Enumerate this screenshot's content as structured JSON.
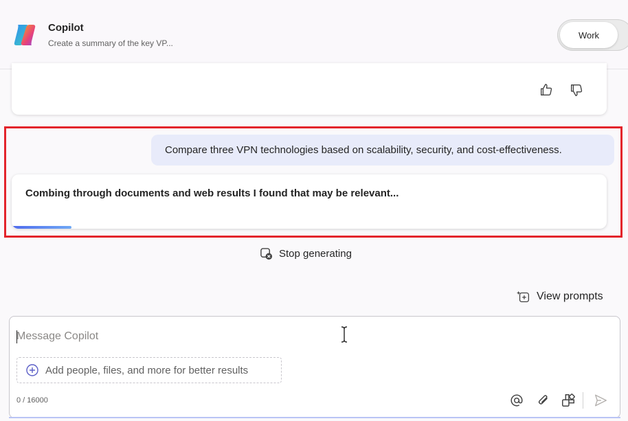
{
  "header": {
    "app_title": "Copilot",
    "subtitle": "Create a summary of the key VP...",
    "toggle_label": "Work"
  },
  "conversation": {
    "user_message": "Compare three VPN technologies based on scalability, security, and cost-effectiveness.",
    "response_status": "Combing through documents and web results I found that may be relevant...",
    "progress_fraction": 0.1
  },
  "actions": {
    "stop_label": "Stop generating",
    "view_prompts_label": "View prompts"
  },
  "composer": {
    "placeholder": "Message Copilot",
    "value": "",
    "add_people_label": "Add people, files, and more for better results",
    "char_count": "0 / 16000"
  },
  "icons": {
    "logo": "copilot-logo",
    "thumbs_up": "thumbs-up-icon",
    "thumbs_down": "thumbs-down-icon",
    "stop": "stop-icon",
    "view_prompts": "prompts-icon",
    "add": "plus-circle-icon",
    "mention": "at-icon",
    "attach": "paperclip-icon",
    "apps": "apps-icon",
    "send": "send-icon"
  },
  "colors": {
    "highlight_border": "#e3242b",
    "user_bubble": "#e8ebfa",
    "accent": "#4f6bed"
  }
}
